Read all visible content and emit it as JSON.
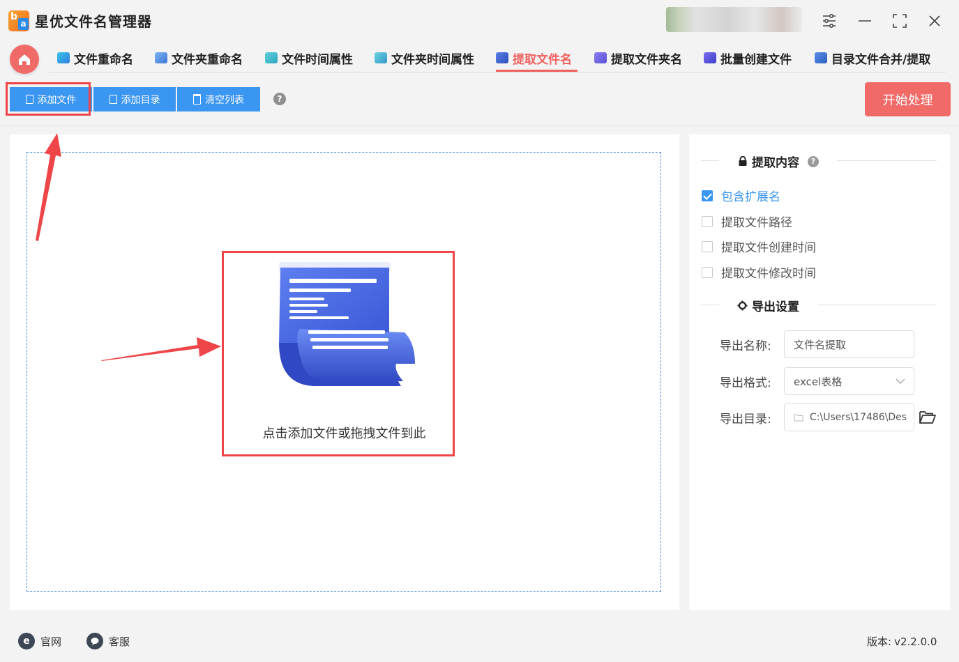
{
  "app": {
    "title": "星优文件名管理器",
    "window_controls": [
      "settings-icon",
      "minimize-icon",
      "maximize-icon",
      "close-icon"
    ]
  },
  "tabs": [
    {
      "label": "文件重命名",
      "icon": "rename-file-icon"
    },
    {
      "label": "文件夹重命名",
      "icon": "rename-folder-icon"
    },
    {
      "label": "文件时间属性",
      "icon": "file-time-icon"
    },
    {
      "label": "文件夹时间属性",
      "icon": "folder-time-icon"
    },
    {
      "label": "提取文件名",
      "icon": "extract-filename-icon",
      "active": true
    },
    {
      "label": "提取文件夹名",
      "icon": "extract-foldername-icon"
    },
    {
      "label": "批量创建文件",
      "icon": "batch-create-icon"
    },
    {
      "label": "目录文件合并/提取",
      "icon": "merge-extract-icon"
    }
  ],
  "toolbar": {
    "add_file": "添加文件",
    "add_dir": "添加目录",
    "clear_list": "清空列表",
    "help": "?",
    "start": "开始处理"
  },
  "dropzone": {
    "hint": "点击添加文件或拖拽文件到此",
    "icon": "document-scroll-icon"
  },
  "extract_section": {
    "title": "提取内容",
    "options": [
      {
        "label": "包含扩展名",
        "checked": true
      },
      {
        "label": "提取文件路径",
        "checked": false
      },
      {
        "label": "提取文件创建时间",
        "checked": false
      },
      {
        "label": "提取文件修改时间",
        "checked": false
      }
    ]
  },
  "export_section": {
    "title": "导出设置",
    "name_label": "导出名称:",
    "name_value": "文件名提取",
    "format_label": "导出格式:",
    "format_value": "excel表格",
    "dir_label": "导出目录:",
    "dir_value": "C:\\Users\\17486\\Des"
  },
  "footer": {
    "website": "官网",
    "support": "客服",
    "version_label": "版本:",
    "version": "v2.2.0.0"
  },
  "colors": {
    "accent_blue": "#3b96f1",
    "accent_red": "#f06a67",
    "annotation_red": "#ee4548"
  }
}
